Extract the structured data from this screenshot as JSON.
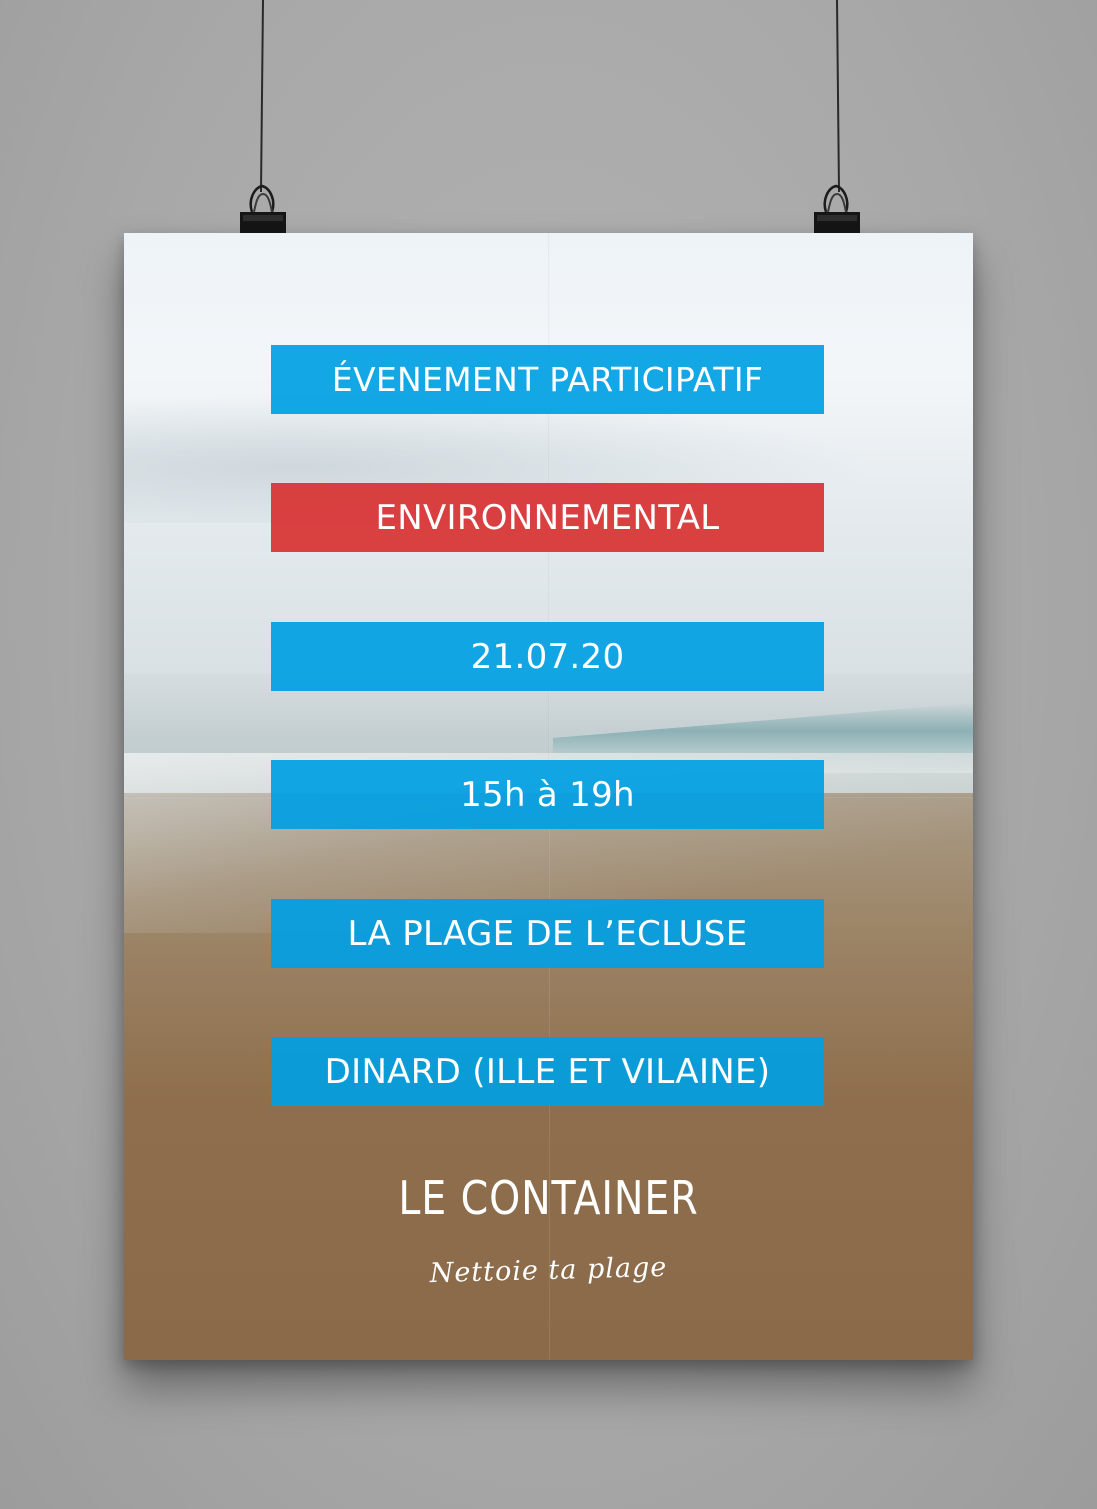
{
  "poster": {
    "banners": [
      {
        "text": "ÉVENEMENT PARTICIPATIF",
        "color": "#00a0e4"
      },
      {
        "text": "ENVIRONNEMENTAL",
        "color": "#d83131"
      },
      {
        "text": "21.07.20",
        "color": "#00a0e4"
      },
      {
        "text": "15h à 19h",
        "color": "#00a0e4"
      },
      {
        "text": "LA PLAGE DE L’ECLUSE",
        "color": "#00a0e4"
      },
      {
        "text": "DINARD (ILLE ET VILAINE)",
        "color": "#00a0e4"
      }
    ],
    "brand": "LE CONTAINER",
    "tagline": "Nettoie ta plage"
  },
  "icons": {
    "clip_left": "binder-clip-icon",
    "clip_right": "binder-clip-icon"
  }
}
